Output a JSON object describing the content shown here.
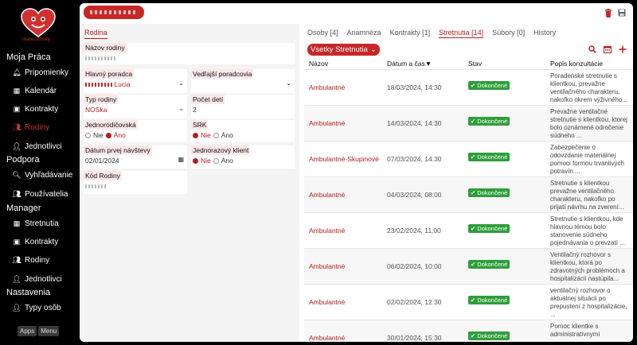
{
  "sidebar": {
    "logo_text": "matecansky",
    "sections": {
      "moja_praca": "Moja Práca",
      "podpora": "Podpora",
      "manager": "Manager",
      "nastavenia": "Nastavenia"
    },
    "items": {
      "pripomienky": "Pripomienky",
      "kalendar": "Kalendár",
      "kontrakty": "Kontrakty",
      "rodiny": "Rodiny",
      "jednotlivci": "Jednotlivci",
      "vyhladavanie": "Vyhľadávanie",
      "pouzivatelia": "Používatelia",
      "stretnutia_m": "Stretnutia",
      "kontrakty_m": "Kontrakty",
      "rodiny_m": "Rodiny",
      "jednotlivci_m": "Jednotlivci",
      "typy_osob": "Typy osôb"
    },
    "apps_label": "Apps",
    "menu_label": "Menu"
  },
  "form": {
    "tab": "Rodina",
    "nazov_label": "Názov rodiny",
    "hlavny_label": "Hlavný poradca",
    "hlavny_value": "Lucia",
    "vedlajsi_label": "Vedľajší poradcovia",
    "typ_label": "Typ rodiny",
    "typ_value": "NOSka",
    "pocet_label": "Počet detí",
    "pocet_value": "2",
    "jednorod_label": "Jednorodičovská",
    "srk_label": "SRK",
    "nie": "Nie",
    "ano": "Áno",
    "datum_label": "Dátum prvej návštevy",
    "datum_value": "02/01/2024",
    "jednorazovy_label": "Jednorazový klient",
    "kod_label": "Kód Rodiny"
  },
  "tabs": [
    {
      "label": "Osoby [4]",
      "active": false
    },
    {
      "label": "Anamnéza",
      "active": false
    },
    {
      "label": "Kontrakty [1]",
      "active": false
    },
    {
      "label": "Stretnutia [14]",
      "active": true
    },
    {
      "label": "Súbory [0]",
      "active": false
    },
    {
      "label": "History",
      "active": false
    }
  ],
  "filter_label": "Vsetky Stretnutia",
  "columns": {
    "nazov": "Názov",
    "datum": "Dátum a čas▼",
    "stav": "Stav",
    "popis": "Popis konzultácie"
  },
  "rows": [
    {
      "type": "Ambulantné",
      "datetime": "18/03/2024, 14:30",
      "status": "Dokončené",
      "desc": "Poradenské stretnutie s klientkou, prevažne ventilačného charakteru, nakoľko okrem výživného..."
    },
    {
      "type": "Ambulantné",
      "datetime": "14/03/2024, 14:30",
      "status": "Dokončené",
      "desc": "Prevažne ventilačné stretnutie s klientkou, ktorej bolo oznámené odročenie súdneho ..."
    },
    {
      "type": "Ambulantné-Skupinové",
      "datetime": "07/03/2024, 14:30",
      "status": "Dokončené",
      "desc": "Zabezpečenie o odovzdanie materiálnej pomoci formou trvanlivých potravín ..."
    },
    {
      "type": "Ambulantné",
      "datetime": "04/03/2024, 08:00",
      "status": "Dokončené",
      "desc": "Stretnutie s klientkou prevažne ventilačného charakteru, nakoľko po prijatí návrhu na zverení..."
    },
    {
      "type": "Ambulantné",
      "datetime": "23/02/2024, 11:00",
      "status": "Dokončené",
      "desc": "Stretnutie s klientkou, kde hlavnou témou bolo stanovenie súdneho pojednávania o prevzatí ..."
    },
    {
      "type": "Ambulantné",
      "datetime": "06/02/2024, 10:00",
      "status": "Dokončené",
      "desc": "Ventilačný rozhovor s klientkou, ktorá po zdravotných problémoch a hospitalizácii nastúpila..."
    },
    {
      "type": "Ambulantné",
      "datetime": "02/02/2024, 12:30",
      "status": "Dokončené",
      "desc": "ventilačný rozhovor o aktuálnej situácii po prepustení z hospitalizácie, ..."
    },
    {
      "type": "Ambulantné",
      "datetime": "30/01/2024, 15:30",
      "status": "Dokončené",
      "desc": "Pomoc klientke s administratívnymi"
    }
  ]
}
